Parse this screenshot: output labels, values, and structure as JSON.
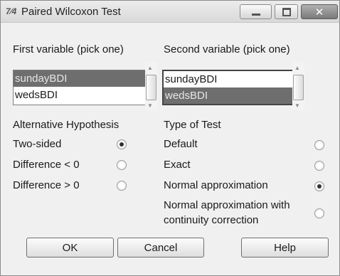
{
  "window": {
    "app_icon": "7⁄4",
    "title": "Paired Wilcoxon Test",
    "controls": [
      "minimize-icon",
      "maximize-icon",
      "close-icon"
    ]
  },
  "first_variable": {
    "label": "First variable (pick one)",
    "items": [
      {
        "label": "sundayBDI",
        "selected": true
      },
      {
        "label": "wedsBDI",
        "selected": false
      }
    ]
  },
  "second_variable": {
    "label": "Second variable (pick one)",
    "items": [
      {
        "label": "sundayBDI",
        "selected": false
      },
      {
        "label": "wedsBDI",
        "selected": true
      }
    ]
  },
  "alternative": {
    "label": "Alternative Hypothesis",
    "options": [
      {
        "label": "Two-sided",
        "checked": true
      },
      {
        "label": "Difference < 0",
        "checked": false
      },
      {
        "label": "Difference > 0",
        "checked": false
      }
    ]
  },
  "test_type": {
    "label": "Type of Test",
    "options": [
      {
        "label": "Default",
        "checked": false
      },
      {
        "label": "Exact",
        "checked": false
      },
      {
        "label": "Normal approximation",
        "checked": true
      },
      {
        "label_line1": "Normal approximation with",
        "label_line2": "continuity correction",
        "checked": false
      }
    ]
  },
  "buttons": {
    "ok": "OK",
    "cancel": "Cancel",
    "help": "Help"
  }
}
